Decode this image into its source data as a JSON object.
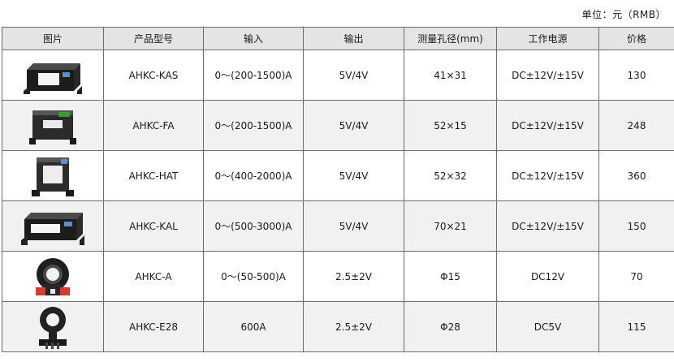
{
  "unit_label": "单位：元（RMB）",
  "headers": [
    "图片",
    "产品型号",
    "输入",
    "输出",
    "测量孔径(mm)",
    "工作电源",
    "价格"
  ],
  "rows": [
    {
      "image_icon": "sensor-kas-icon",
      "model": "AHKC-KAS",
      "input": "0～(200-1500)A",
      "output": "5V/4V",
      "aperture": "41×31",
      "power": "DC±12V/±15V",
      "price": "130"
    },
    {
      "image_icon": "sensor-fa-icon",
      "model": "AHKC-FA",
      "input": "0～(200-1500)A",
      "output": "5V/4V",
      "aperture": "52×15",
      "power": "DC±12V/±15V",
      "price": "248"
    },
    {
      "image_icon": "sensor-hat-icon",
      "model": "AHKC-HAT",
      "input": "0～(400-2000)A",
      "output": "5V/4V",
      "aperture": "52×32",
      "power": "DC±12V/±15V",
      "price": "360"
    },
    {
      "image_icon": "sensor-kal-icon",
      "model": "AHKC-KAL",
      "input": "0～(500-3000)A",
      "output": "5V/4V",
      "aperture": "70×21",
      "power": "DC±12V/±15V",
      "price": "150"
    },
    {
      "image_icon": "sensor-a-icon",
      "model": "AHKC-A",
      "input": "0～(50-500)A",
      "output": "2.5±2V",
      "aperture": "Φ15",
      "power": "DC12V",
      "price": "70"
    },
    {
      "image_icon": "sensor-e28-icon",
      "model": "AHKC-E28",
      "input": "600A",
      "output": "2.5±2V",
      "aperture": "Φ28",
      "power": "DC5V",
      "price": "115"
    }
  ]
}
